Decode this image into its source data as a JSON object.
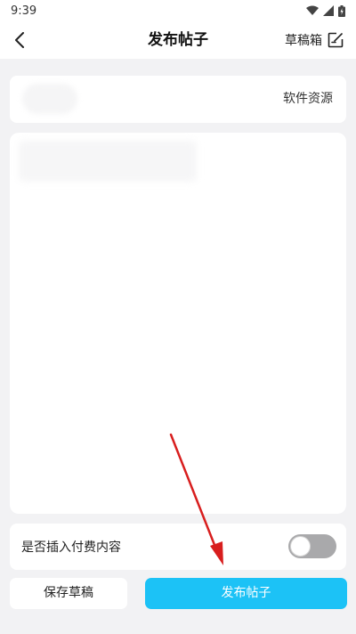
{
  "status_bar": {
    "time": "9:39"
  },
  "header": {
    "title": "发布帖子",
    "drafts_label": "草稿箱"
  },
  "category": {
    "value": "软件资源"
  },
  "paid_content": {
    "label": "是否插入付费内容",
    "enabled": false
  },
  "actions": {
    "save_draft_label": "保存草稿",
    "publish_label": "发布帖子"
  },
  "colors": {
    "accent": "#1cc2f6",
    "annotation_arrow": "#d81e1e",
    "toggle_off": "#a9a9ab"
  },
  "icons": [
    "back-arrow-icon",
    "edit-note-icon",
    "wifi-icon",
    "signal-icon",
    "battery-icon"
  ]
}
